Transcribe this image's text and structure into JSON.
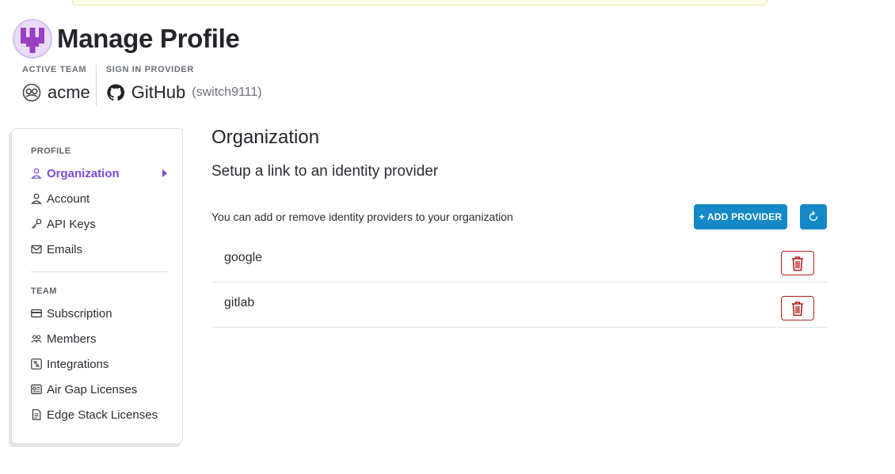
{
  "header": {
    "title": "Manage Profile",
    "avatar_icon": "trident-logo-icon"
  },
  "meta": {
    "active_team_label": "ACTIVE TEAM",
    "active_team_value": "acme",
    "active_team_icon": "team-avatar-icon",
    "sign_in_label": "SIGN IN PROVIDER",
    "sign_in_value": "GitHub",
    "sign_in_icon": "github-icon",
    "sign_in_username": "(switch9111)"
  },
  "sidebar": {
    "profile_section": "PROFILE",
    "team_section": "TEAM",
    "profile_items": [
      {
        "label": "Organization",
        "icon": "user-icon",
        "active": true
      },
      {
        "label": "Account",
        "icon": "user-icon"
      },
      {
        "label": "API Keys",
        "icon": "key-icon"
      },
      {
        "label": "Emails",
        "icon": "mail-icon"
      }
    ],
    "team_items": [
      {
        "label": "Subscription",
        "icon": "credit-card-icon"
      },
      {
        "label": "Members",
        "icon": "members-icon"
      },
      {
        "label": "Integrations",
        "icon": "integrations-icon"
      },
      {
        "label": "Air Gap Licenses",
        "icon": "license-icon"
      },
      {
        "label": "Edge Stack Licenses",
        "icon": "document-icon"
      }
    ]
  },
  "main": {
    "title": "Organization",
    "subtitle": "Setup a link to an identity provider",
    "description": "You can add or remove identity providers to your organization",
    "add_button": "+ ADD PROVIDER",
    "refresh_icon": "refresh-icon",
    "providers": [
      {
        "name": "google"
      },
      {
        "name": "gitlab"
      }
    ],
    "delete_icon": "trash-icon"
  },
  "colors": {
    "accent": "#7a4bd6",
    "primary_button": "#1589c7",
    "danger": "#b32020"
  }
}
